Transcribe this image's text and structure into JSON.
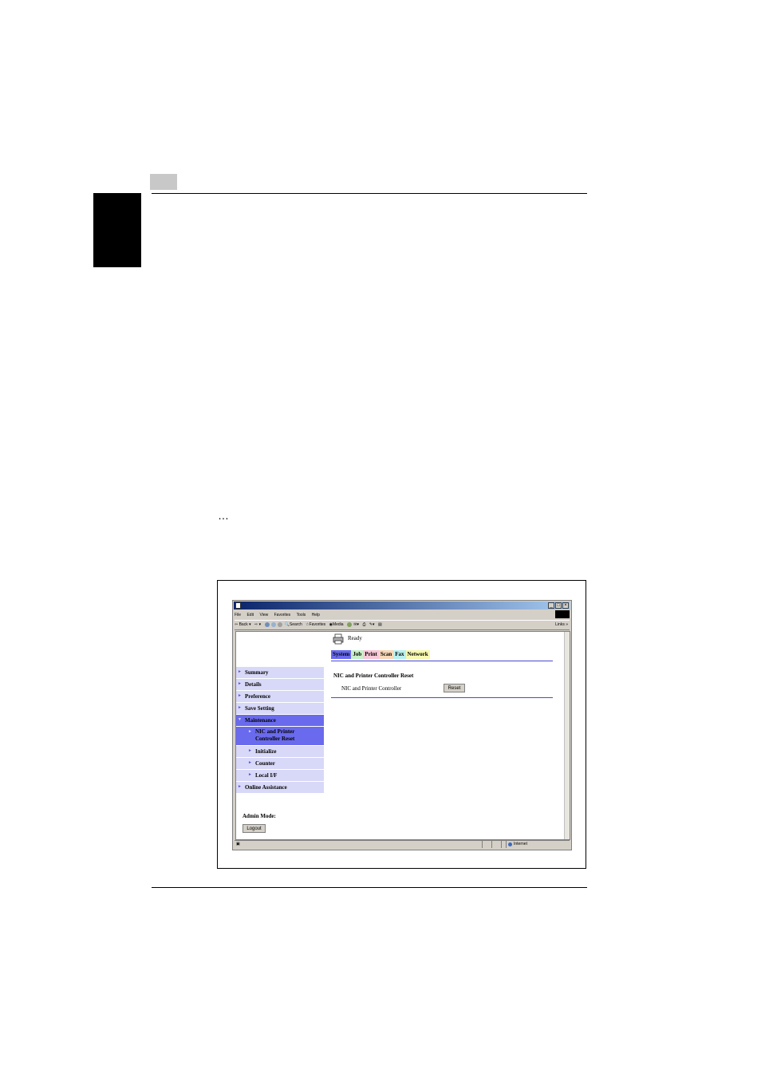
{
  "page": {
    "ellipsis": "…"
  },
  "browser": {
    "menu": [
      "File",
      "Edit",
      "View",
      "Favorites",
      "Tools",
      "Help"
    ],
    "toolbar": {
      "back": "Back",
      "search": "Search",
      "favorites": "Favorites",
      "media": "Media",
      "links": "Links"
    },
    "status_zone": "Internet"
  },
  "app": {
    "status": "Ready",
    "tabs": [
      {
        "label": "System",
        "color": "#6a6aee"
      },
      {
        "label": "Job",
        "color": "#c8f0c8"
      },
      {
        "label": "Print",
        "color": "#f8c8d8"
      },
      {
        "label": "Scan",
        "color": "#f8d8b8"
      },
      {
        "label": "Fax",
        "color": "#b8f0f0"
      },
      {
        "label": "Network",
        "color": "#f8f8b0"
      }
    ],
    "nav": {
      "summary": "Summary",
      "details": "Details",
      "preference": "Preference",
      "save_setting": "Save Setting",
      "maintenance": "Maintenance",
      "nic_reset_line1": "NIC and Printer",
      "nic_reset_line2": "Controller Reset",
      "initialize": "Initialize",
      "counter": "Counter",
      "local_if": "Local I/F",
      "online_assistance": "Online Assistance"
    },
    "admin_mode_label": "Admin Mode:",
    "logout_label": "Logout",
    "content": {
      "title": "NIC and Printer Controller Reset",
      "row_label": "NIC and Printer Controller",
      "reset_label": "Reset"
    }
  }
}
